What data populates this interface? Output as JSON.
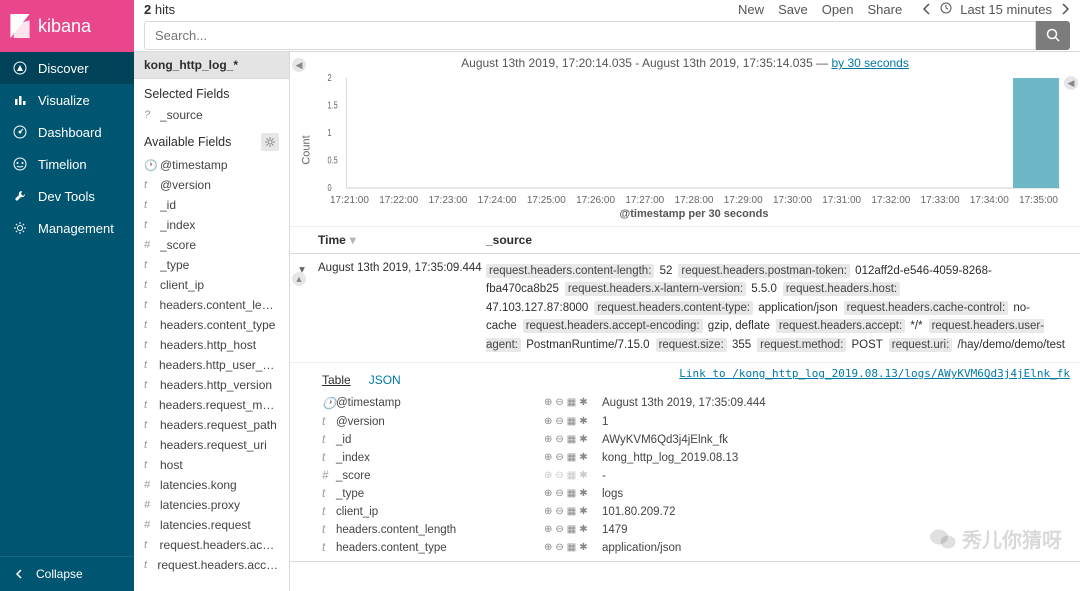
{
  "brand": "kibana",
  "nav": {
    "items": [
      {
        "icon": "compass",
        "label": "Discover",
        "active": true
      },
      {
        "icon": "bar",
        "label": "Visualize"
      },
      {
        "icon": "gauge",
        "label": "Dashboard"
      },
      {
        "icon": "timelion",
        "label": "Timelion"
      },
      {
        "icon": "wrench",
        "label": "Dev Tools"
      },
      {
        "icon": "gear",
        "label": "Management"
      }
    ],
    "collapse": "Collapse"
  },
  "topbar": {
    "hits_count": "2",
    "hits_label": "hits",
    "search_placeholder": "Search...",
    "links": [
      "New",
      "Save",
      "Open",
      "Share"
    ],
    "time_label": "Last 15 minutes"
  },
  "fields": {
    "index_pattern": "kong_http_log_*",
    "selected_header": "Selected Fields",
    "selected": [
      {
        "t": "?",
        "n": "_source"
      }
    ],
    "available_header": "Available Fields",
    "available": [
      {
        "t": "🕐",
        "n": "@timestamp"
      },
      {
        "t": "t",
        "n": "@version"
      },
      {
        "t": "t",
        "n": "_id"
      },
      {
        "t": "t",
        "n": "_index"
      },
      {
        "t": "#",
        "n": "_score"
      },
      {
        "t": "t",
        "n": "_type"
      },
      {
        "t": "t",
        "n": "client_ip"
      },
      {
        "t": "t",
        "n": "headers.content_length"
      },
      {
        "t": "t",
        "n": "headers.content_type"
      },
      {
        "t": "t",
        "n": "headers.http_host"
      },
      {
        "t": "t",
        "n": "headers.http_user_agent"
      },
      {
        "t": "t",
        "n": "headers.http_version"
      },
      {
        "t": "t",
        "n": "headers.request_method"
      },
      {
        "t": "t",
        "n": "headers.request_path"
      },
      {
        "t": "t",
        "n": "headers.request_uri"
      },
      {
        "t": "t",
        "n": "host"
      },
      {
        "t": "#",
        "n": "latencies.kong"
      },
      {
        "t": "#",
        "n": "latencies.proxy"
      },
      {
        "t": "#",
        "n": "latencies.request"
      },
      {
        "t": "t",
        "n": "request.headers.accept"
      },
      {
        "t": "t",
        "n": "request.headers.accept-enco..."
      }
    ]
  },
  "time_header": {
    "from": "August 13th 2019, 17:20:14.035",
    "to": "August 13th 2019, 17:35:14.035",
    "interval_link": "by 30 seconds"
  },
  "chart_data": {
    "type": "bar",
    "ylabel": "Count",
    "xlabel": "@timestamp per 30 seconds",
    "yticks": [
      "0",
      "0.5",
      "1",
      "1.5",
      "2"
    ],
    "ylim": [
      0,
      2
    ],
    "categories": [
      "17:21:00",
      "17:22:00",
      "17:23:00",
      "17:24:00",
      "17:25:00",
      "17:26:00",
      "17:27:00",
      "17:28:00",
      "17:29:00",
      "17:30:00",
      "17:31:00",
      "17:32:00",
      "17:33:00",
      "17:34:00",
      "17:35:00"
    ],
    "values": [
      0,
      0,
      0,
      0,
      0,
      0,
      0,
      0,
      0,
      0,
      0,
      0,
      0,
      0,
      2
    ]
  },
  "table": {
    "head_time": "Time",
    "head_source": "_source",
    "row": {
      "time": "August 13th 2019, 17:35:09.444",
      "kv": [
        {
          "k": "request.headers.content-length:",
          "v": "52"
        },
        {
          "k": "request.headers.postman-token:",
          "v": "012aff2d-e546-4059-8268-fba470ca8b25"
        },
        {
          "k": "request.headers.x-lantern-version:",
          "v": "5.5.0"
        },
        {
          "k": "request.headers.host:",
          "v": "47.103.127.87:8000"
        },
        {
          "k": "request.headers.content-type:",
          "v": "application/json"
        },
        {
          "k": "request.headers.cache-control:",
          "v": "no-cache"
        },
        {
          "k": "request.headers.accept-encoding:",
          "v": "gzip, deflate"
        },
        {
          "k": "request.headers.accept:",
          "v": "*/*"
        },
        {
          "k": "request.headers.user-agent:",
          "v": "PostmanRuntime/7.15.0"
        },
        {
          "k": "request.size:",
          "v": "355"
        },
        {
          "k": "request.method:",
          "v": "POST"
        },
        {
          "k": "request.uri:",
          "v": "/hay/demo/demo/test"
        }
      ]
    },
    "detail": {
      "tabs": [
        "Table",
        "JSON"
      ],
      "link": "Link to /kong_http_log_2019.08.13/logs/AWyKVM6Qd3j4jElnk_fk",
      "rows": [
        {
          "t": "🕐",
          "k": "@timestamp",
          "v": "August 13th 2019, 17:35:09.444"
        },
        {
          "t": "t",
          "k": "@version",
          "v": "1"
        },
        {
          "t": "t",
          "k": "_id",
          "v": "AWyKVM6Qd3j4jElnk_fk"
        },
        {
          "t": "t",
          "k": "_index",
          "v": "kong_http_log_2019.08.13"
        },
        {
          "t": "#",
          "k": "_score",
          "v": "-",
          "muted": true
        },
        {
          "t": "t",
          "k": "_type",
          "v": "logs"
        },
        {
          "t": "t",
          "k": "client_ip",
          "v": "101.80.209.72"
        },
        {
          "t": "t",
          "k": "headers.content_length",
          "v": "1479"
        },
        {
          "t": "t",
          "k": "headers.content_type",
          "v": "application/json"
        }
      ]
    }
  },
  "watermark": "秀儿你猜呀"
}
